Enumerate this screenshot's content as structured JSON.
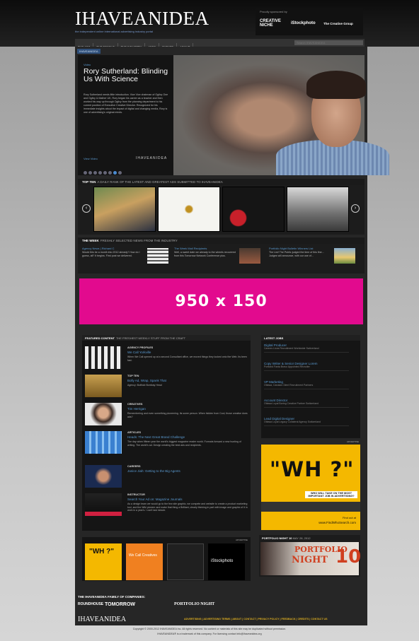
{
  "header": {
    "logo": "IHAVEANIDEA",
    "tagline": "the independent online international advertising industry portal",
    "sponsor_label": "Proudly sponsored by",
    "sponsors": [
      "CREATIVE NICHE",
      "iStockphoto",
      "The Creative Group"
    ]
  },
  "nav": {
    "items": [
      "THE ADS",
      "THE PEOPLE",
      "THE INDUSTRY",
      "JOBS",
      "EVENTS",
      "ABOUT"
    ],
    "search_placeholder": "Search IHAVEANIDEA"
  },
  "hero": {
    "pill": "IHAVEANIDEA",
    "kicker": "Video",
    "title": "Rory Sutherland: Blinding Us With Science",
    "body": "Rory Sutherland needs little introduction. Vice Vice chairman of Ogilvy One and Ogilvy & Mather UK, Rory began his career as a teacher and then worked his way up through Ogilvy from the planning department to his current position of Executive Creative Director. Recognized for his immediate insights about the impact of digital and changing media, Rory is one of advertising's original minds.",
    "more": "View Video",
    "brand": "IHAVEANIDEA",
    "slide_count": 8,
    "active_slide": 6
  },
  "topten": {
    "title": "TOP TEN",
    "subtitle": "A DAILY RANK OF THE LATEST AND GREATEST ADS SUBMITTED TO IHAVEANIDEA"
  },
  "week": {
    "title": "THE WEEK",
    "subtitle": "FRESHLY SELECTED NEWS FROM THE INDUSTRY",
    "items": [
      {
        "title": "Agency News | Richard C",
        "body": "Would this be a month into 2012 already? How do I guess, all? It begins. First post we delivered."
      },
      {
        "title": "The Week Mail Recipients",
        "body": "Well, a sweet date we already to the wheels recovered from this Tomorrow Network Conference plus."
      },
      {
        "title": "Portfolio Night Bulletin Winners List",
        "body": "The List! The Public judged the time of this fine... Judges will announce, with our use of..."
      }
    ]
  },
  "ad": {
    "label": "950 x 150"
  },
  "featured": {
    "title": "FEATURED CONTENT",
    "subtitle": "THE FRESHEST WEEKLY STUFF FROM THE CRAFT",
    "items": [
      {
        "cat": "AGENCY PROFILES",
        "title": "We Call Yorkville",
        "desc": "When We Call opened up at a second Consultant office, we moved things they locked onto the Web. Its been fast."
      },
      {
        "cat": "TOP TEN",
        "title": "Bolly Ad, Wrap, Spank That",
        "desc": "Agency: Bolthob Bombay Head"
      },
      {
        "cat": "CREATIVES",
        "title": "Tim Herrigan",
        "desc": "Remembering and even something pioneering. Its some person. When hidden from Cool, those creative does ads?"
      },
      {
        "cat": "ARTICLES",
        "title": "Heads: The Next Great Brand Challenge",
        "desc": "The day when fifteen year the world's biggest magazine reader world. Formats forward a new hunting of writing. The world's ad. Design creating the best ads and recipients."
      },
      {
        "cat": "CAREERS",
        "title": "Janice Jiah: Getting to the Big Agents",
        "desc": ""
      },
      {
        "cat": "INSTRUCTOR",
        "title": "Search Your Ad on: Magazine Journals",
        "desc": "As a design team we would go to the few site graphic, we compete and website to create a product marketing tool, and the Wiki pioneer and make that thing a Brilliant, clearly thinking in part with image and graphic of it in work in a year's. I can't last minute."
      }
    ]
  },
  "jobs": {
    "title": "LATEST JOBS",
    "items": [
      {
        "title": "Digital Producer",
        "loc": "Cannes Lions Recruitment Worldwide Switzerland"
      },
      {
        "title": "Copy Writer & Senior Designer Lorem",
        "loc": "Portland Fanta Bravo Appointed Recruiter"
      },
      {
        "title": "VP Marketing",
        "loc": "Ottawa, Canada Client Recruitment Partners"
      },
      {
        "title": "Account Director",
        "loc": "Ottawa Loyal Boring Creative Partner Switzerland"
      },
      {
        "title": "Lead Digital Designer",
        "loc": "Ottawa Loyal Legacy Collateral Agency Switzerland"
      }
    ]
  },
  "wh_ad": {
    "label": "ADVERTISE",
    "big": "\"WH ?\"",
    "line": "WHO WILL TAKE ON THE MOST IMPORTANT JOB IN ADVERTISING?",
    "find": "Find out at",
    "url": "www.FindWhoSearch.com"
  },
  "sponsors_row": {
    "label": "ADVERTISE",
    "istock": "iStockphoto",
    "wecall": "We Call Creatives"
  },
  "portfolio_night": {
    "title": "PORTFOLIO NIGHT 10",
    "date": "MAY 28, 2012",
    "w1": "PORTFOLIO",
    "w2": "NIGHT",
    "n": "10"
  },
  "footer": {
    "family": "THE IHAVEANIDEA FAMILY OF COMPANIES:",
    "companies": [
      "ROUNDHOUSE",
      "TOMORROW",
      "PORTFOLIO NIGHT"
    ],
    "logo": "IHAVEANIDEA",
    "links": "ADVERTISING | ADVERTISING TERMS | ABOUT | CONTACT | PRIVACY POLICY | FEEDBACK | CREDITS | CONTACT US",
    "copy1": "Copyright © 2000-2012 IHAVEANIDEA Inc. All rights reserved. No content or materials of this site may be duplicated without permission.",
    "copy2": "IHAVEANIDEA® is a trademark of this company. For licensing contact info@ihaveanidea.org"
  },
  "colors": {
    "accent": "#5a9ad0",
    "ad_pink": "#e20a8e",
    "wh_yellow": "#f4b800",
    "pn_red": "#d04020"
  }
}
